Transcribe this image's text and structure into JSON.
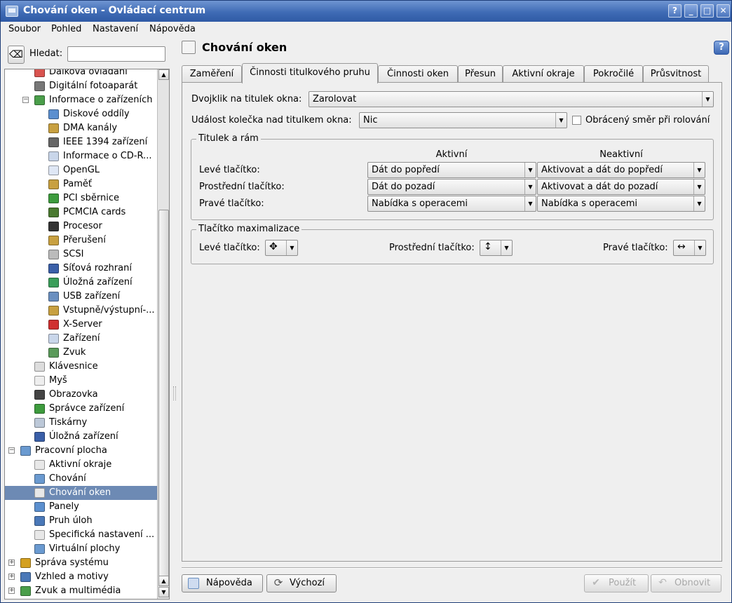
{
  "window": {
    "title": "Chování oken - Ovládací centrum",
    "buttons": {
      "help": "?",
      "minimize": "_",
      "maximize": "□",
      "close": "✕"
    }
  },
  "menubar": [
    "Soubor",
    "Pohled",
    "Nastavení",
    "Nápověda"
  ],
  "search": {
    "label": "Hledat:",
    "value": ""
  },
  "tree": [
    {
      "label": "Dálková ovládání",
      "level": 2,
      "icon": "remote-icon",
      "color": "#d9534f"
    },
    {
      "label": "Digitální fotoaparát",
      "level": 2,
      "icon": "camera-icon",
      "color": "#777777"
    },
    {
      "label": "Informace o zařízeních",
      "level": 2,
      "icon": "hardware-info-icon",
      "color": "#4a9e4a",
      "expander": "minus"
    },
    {
      "label": "Diskové oddíly",
      "level": 3,
      "icon": "disk-partition-icon",
      "color": "#5b8fcf"
    },
    {
      "label": "DMA kanály",
      "level": 3,
      "icon": "dma-icon",
      "color": "#c8a040"
    },
    {
      "label": "IEEE 1394 zařízení",
      "level": 3,
      "icon": "firewire-icon",
      "color": "#666666"
    },
    {
      "label": "Informace o CD-R...",
      "level": 3,
      "icon": "cdrom-icon",
      "color": "#c9d6ea"
    },
    {
      "label": "OpenGL",
      "level": 3,
      "icon": "opengl-icon",
      "color": "#dfe7f5"
    },
    {
      "label": "Paměť",
      "level": 3,
      "icon": "memory-icon",
      "color": "#c8a040"
    },
    {
      "label": "PCI sběrnice",
      "level": 3,
      "icon": "pci-icon",
      "color": "#3d9b3d"
    },
    {
      "label": "PCMCIA cards",
      "level": 3,
      "icon": "pcmcia-icon",
      "color": "#4a7a30"
    },
    {
      "label": "Procesor",
      "level": 3,
      "icon": "cpu-icon",
      "color": "#333333"
    },
    {
      "label": "Přerušení",
      "level": 3,
      "icon": "interrupt-icon",
      "color": "#c8a040"
    },
    {
      "label": "SCSI",
      "level": 3,
      "icon": "scsi-icon",
      "color": "#bbbbbb"
    },
    {
      "label": "Síťová rozhraní",
      "level": 3,
      "icon": "network-icon",
      "color": "#3a5fa8"
    },
    {
      "label": "Úložná zařízení",
      "level": 3,
      "icon": "storage-icon",
      "color": "#3a9e5a"
    },
    {
      "label": "USB zařízení",
      "level": 3,
      "icon": "usb-icon",
      "color": "#6a8fc0"
    },
    {
      "label": "Vstupně/výstupní-...",
      "level": 3,
      "icon": "io-port-icon",
      "color": "#c8a040"
    },
    {
      "label": "X-Server",
      "level": 3,
      "icon": "x-server-icon",
      "color": "#d03030"
    },
    {
      "label": "Zařízení",
      "level": 3,
      "icon": "devices-icon",
      "color": "#c9d6ea"
    },
    {
      "label": "Zvuk",
      "level": 3,
      "icon": "sound-icon",
      "color": "#5a9a5a"
    },
    {
      "label": "Klávesnice",
      "level": 2,
      "icon": "keyboard-icon",
      "color": "#dddddd"
    },
    {
      "label": "Myš",
      "level": 2,
      "icon": "mouse-icon",
      "color": "#eeeeee"
    },
    {
      "label": "Obrazovka",
      "level": 2,
      "icon": "display-icon",
      "color": "#444444"
    },
    {
      "label": "Správce zařízení",
      "level": 2,
      "icon": "device-manager-icon",
      "color": "#3d9b3d"
    },
    {
      "label": "Tiskárny",
      "level": 2,
      "icon": "printer-icon",
      "color": "#bcc8d8"
    },
    {
      "label": "Úložná zařízení",
      "level": 2,
      "icon": "storage-icon",
      "color": "#3a5fa8"
    },
    {
      "label": "Pracovní plocha",
      "level": 1,
      "icon": "desktop-icon",
      "color": "#6a9ad0",
      "expander": "minus"
    },
    {
      "label": "Aktivní okraje",
      "level": 2,
      "icon": "active-edges-icon",
      "color": "#e8e8e8"
    },
    {
      "label": "Chování",
      "level": 2,
      "icon": "behavior-icon",
      "color": "#6a9ad0"
    },
    {
      "label": "Chování oken",
      "level": 2,
      "icon": "window-behavior-icon",
      "color": "#e8e8e8",
      "selected": true
    },
    {
      "label": "Panely",
      "level": 2,
      "icon": "panels-icon",
      "color": "#5b8fcf"
    },
    {
      "label": "Pruh úloh",
      "level": 2,
      "icon": "taskbar-icon",
      "color": "#4a78b8"
    },
    {
      "label": "Specifická nastavení ...",
      "level": 2,
      "icon": "window-specific-icon",
      "color": "#e8e8e8"
    },
    {
      "label": "Virtuální plochy",
      "level": 2,
      "icon": "virtual-desktops-icon",
      "color": "#6a9ad0"
    },
    {
      "label": "Správa systému",
      "level": 1,
      "icon": "system-admin-icon",
      "color": "#d4a020",
      "expander": "plus"
    },
    {
      "label": "Vzhled a motivy",
      "level": 1,
      "icon": "appearance-icon",
      "color": "#4a78b8",
      "expander": "plus"
    },
    {
      "label": "Zvuk a multimédia",
      "level": 1,
      "icon": "sound-multimedia-icon",
      "color": "#4a9e4a",
      "expander": "plus"
    }
  ],
  "module": {
    "title": "Chování oken"
  },
  "tabs": [
    "Zaměření",
    "Činnosti titulkového pruhu",
    "Činnosti oken",
    "Přesun",
    "Aktivní okraje",
    "Pokročilé",
    "Průsvitnost"
  ],
  "active_tab": "Činnosti titulkového pruhu",
  "titlebar_actions": {
    "doubleclick_label": "Dvojklik na titulek okna:",
    "doubleclick_value": "Zarolovat",
    "wheel_label": "Událost kolečka nad titulkem okna:",
    "wheel_value": "Nic",
    "reverse_label": "Obrácený směr při rolování",
    "reverse_checked": false
  },
  "title_frame": {
    "group_title": "Titulek a rám",
    "col_active": "Aktivní",
    "col_inactive": "Neaktivní",
    "rows": [
      {
        "label": "Levé tlačítko:",
        "active": "Dát do popředí",
        "inactive": "Aktivovat a dát do popředí"
      },
      {
        "label": "Prostřední tlačítko:",
        "active": "Dát do pozadí",
        "inactive": "Aktivovat a dát do pozadí"
      },
      {
        "label": "Pravé tlačítko:",
        "active": "Nabídka s operacemi",
        "inactive": "Nabídka s operacemi"
      }
    ]
  },
  "maximize_button": {
    "group_title": "Tlačítko maximalizace",
    "left_label": "Levé tlačítko:",
    "left_glyph": "✥",
    "middle_label": "Prostřední tlačítko:",
    "middle_glyph": "↕",
    "right_label": "Pravé tlačítko:",
    "right_glyph": "↔"
  },
  "buttons": {
    "help": "Nápověda",
    "defaults": "Výchozí",
    "apply": "Použít",
    "reset": "Obnovit"
  }
}
